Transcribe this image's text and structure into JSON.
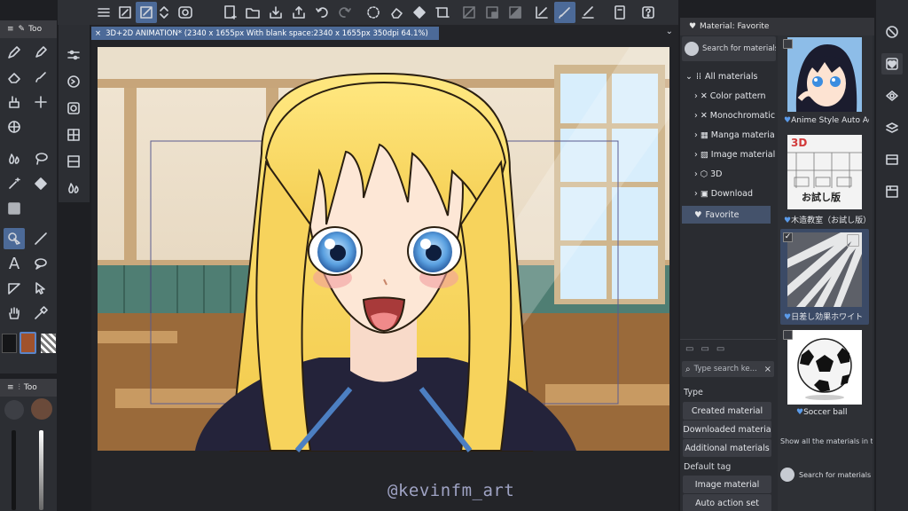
{
  "document_tab": {
    "title": "3D+2D ANIMATION* (2340 x 1655px With blank space:2340 x 1655px 350dpi 64.1%)"
  },
  "tool_panel": {
    "title": "Too"
  },
  "subtool_panel": {
    "title": "Too"
  },
  "material_panel": {
    "title": "Material: Favorite",
    "search_placeholder": "Search for materials on A",
    "tree": [
      "All materials",
      "Color pattern",
      "Monochromatic",
      "Manga materia",
      "Image material",
      "3D",
      "Download",
      "Favorite"
    ],
    "tag_search_placeholder": "Type search ke...",
    "type_heading": "Type",
    "type_buttons": [
      "Created material",
      "Downloaded materia",
      "Additional materials"
    ],
    "default_tag_heading": "Default tag",
    "tag_buttons": [
      "Image material",
      "Auto action set"
    ],
    "materials": [
      {
        "name": "Anime Style Auto Action"
      },
      {
        "name": "木造教室（お試し版）",
        "thumb_label_top": "3D",
        "thumb_label_bottom": "お試し版"
      },
      {
        "name": "日差し効果ホワイト"
      },
      {
        "name": "Soccer ball"
      }
    ],
    "show_all_text": "Show all the materials in the fo",
    "bottom_search": "Search for materials on"
  },
  "watermark": "@kevinfm_art",
  "colors": {
    "main": "#151618",
    "sub": "#ffffff",
    "accent": "#4c6a98",
    "fill_swatch": "#a0522d"
  }
}
